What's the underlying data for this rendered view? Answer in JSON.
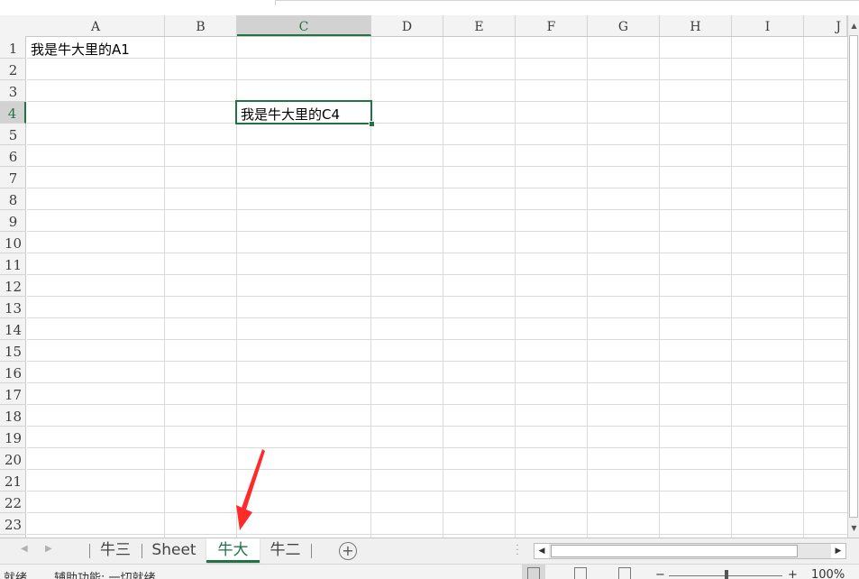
{
  "spreadsheet": {
    "columns": [
      "A",
      "B",
      "C",
      "D",
      "E",
      "F",
      "G",
      "H",
      "I",
      "J"
    ],
    "rows": [
      "1",
      "2",
      "3",
      "4",
      "5",
      "6",
      "7",
      "8",
      "9",
      "10",
      "11",
      "12",
      "13",
      "14",
      "15",
      "16",
      "17",
      "18",
      "19",
      "20",
      "21",
      "22",
      "23"
    ],
    "selected_column": "C",
    "selected_row": "4",
    "cells": {
      "A1": "我是牛大里的A1",
      "C4": "我是牛大里的C4"
    }
  },
  "sheet_tabs": {
    "tabs": [
      "牛三",
      "Sheet",
      "牛大",
      "牛二"
    ],
    "active_tab": "牛大",
    "add_sheet_icon": "plus-circle-icon"
  },
  "status_bar": {
    "ready": "就绪",
    "accessibility": "辅助功能: 一切就绪",
    "zoom_minus": "−",
    "zoom_plus": "+",
    "zoom": "100%"
  },
  "colors": {
    "accent": "#217346",
    "annotation_arrow": "#ff2a2a"
  }
}
